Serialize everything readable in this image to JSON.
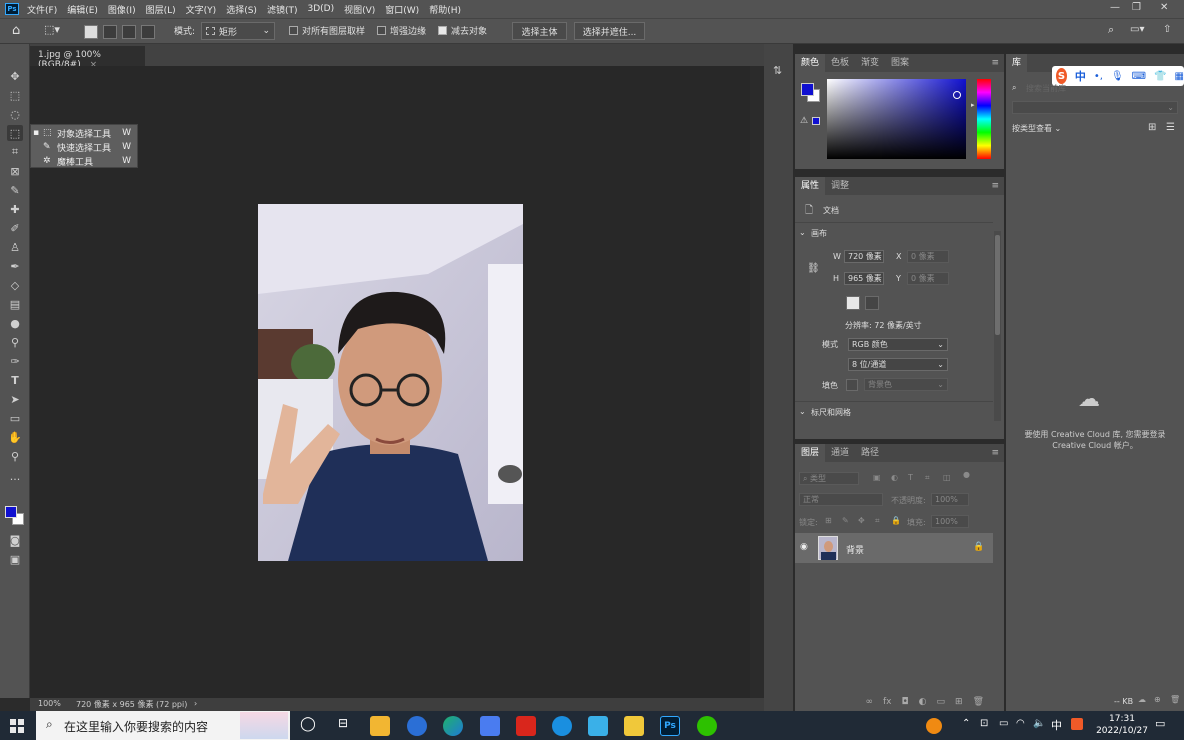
{
  "menubar": {
    "app_logo": "Ps",
    "items": [
      "文件(F)",
      "编辑(E)",
      "图像(I)",
      "图层(L)",
      "文字(Y)",
      "选择(S)",
      "滤镜(T)",
      "3D(D)",
      "视图(V)",
      "窗口(W)",
      "帮助(H)"
    ],
    "window_controls": [
      "—",
      "❐",
      "✕"
    ]
  },
  "optionsbar": {
    "mode_label": "模式:",
    "mode_value": "矩形",
    "sample_all_layers": "对所有图层取样",
    "sample_all_checked": false,
    "enhance_edge": "增强边缘",
    "enhance_edge_checked": false,
    "subtract_object": "减去对象",
    "subtract_checked": true,
    "select_subject_btn": "选择主体",
    "select_mask_btn": "选择并遮住..."
  },
  "document_tab": {
    "title": "1.jpg @ 100%(RGB/8#)",
    "close": "×"
  },
  "flyout": {
    "items": [
      {
        "label": "对象选择工具",
        "key": "W"
      },
      {
        "label": "快速选择工具",
        "key": "W"
      },
      {
        "label": "魔棒工具",
        "key": "W"
      }
    ]
  },
  "statusbar": {
    "zoom": "100%",
    "doc_info": "720 像素 x 965 像素 (72 ppi)",
    "arrow": "›"
  },
  "color_panel": {
    "tabs": [
      "颜色",
      "色板",
      "渐变",
      "图案"
    ],
    "foreground": "#1010d0",
    "background": "#ffffff"
  },
  "properties_panel": {
    "tabs": [
      "属性",
      "调整"
    ],
    "doc_label": "文档",
    "canvas_section": "画布",
    "w_label": "W",
    "w_value": "720 像素",
    "h_label": "H",
    "h_value": "965 像素",
    "x_label": "X",
    "x_placeholder": "0 像素",
    "y_label": "Y",
    "y_placeholder": "0 像素",
    "resolution": "分辨率: 72 像素/英寸",
    "mode_label": "模式",
    "mode_value": "RGB 颜色",
    "depth_value": "8 位/通道",
    "fill_label": "填色",
    "fill_value": "背景色",
    "rulers_section": "标尺和网格"
  },
  "layers_panel": {
    "tabs": [
      "图层",
      "通道",
      "路径"
    ],
    "filter_label": "类型",
    "blend_mode": "正常",
    "opacity_label": "不透明度:",
    "opacity_value": "100%",
    "lock_label": "锁定:",
    "fill_label": "填充:",
    "fill_value": "100%",
    "layers": [
      {
        "name": "背景",
        "visible": true,
        "locked": true
      }
    ],
    "footer_icons": [
      "link-icon",
      "fx-icon",
      "mask-icon",
      "adjustment-icon",
      "group-icon",
      "new-layer-icon",
      "trash-icon"
    ]
  },
  "library_panel": {
    "tab": "库",
    "search_placeholder": "搜索当前库",
    "view_label": "按类型查看",
    "cloud_message_1": "要使用 Creative Cloud 库, 您需要登录",
    "cloud_message_2": "Creative Cloud 帐户。",
    "kb_label": "-- KB"
  },
  "ime": {
    "label": "中"
  },
  "taskbar": {
    "search_placeholder": "在这里输入你要搜索的内容",
    "tray_lang": "中",
    "time": "17:31",
    "date": "2022/10/27"
  }
}
